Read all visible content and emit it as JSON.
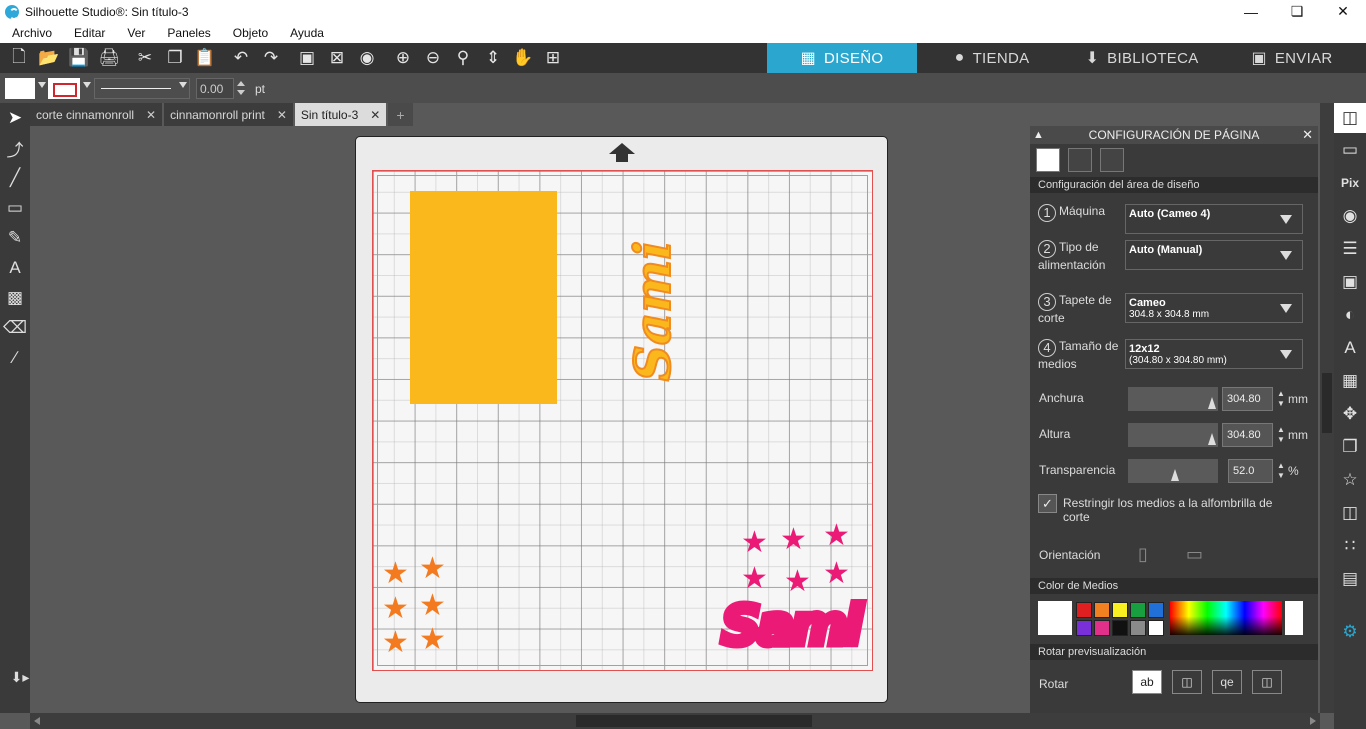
{
  "window": {
    "title": "Silhouette Studio®: Sin título-3"
  },
  "menu": [
    "Archivo",
    "Editar",
    "Ver",
    "Paneles",
    "Objeto",
    "Ayuda"
  ],
  "nav_tabs": [
    {
      "label": "DISEÑO",
      "icon": "grid-icon",
      "active": true
    },
    {
      "label": "TIENDA",
      "icon": "silhouette-s-icon",
      "active": false
    },
    {
      "label": "BIBLIOTECA",
      "icon": "library-icon",
      "active": false
    },
    {
      "label": "ENVIAR",
      "icon": "send-icon",
      "active": false
    }
  ],
  "line_settings": {
    "width_value": "0.00",
    "unit": "pt"
  },
  "doc_tabs": [
    {
      "label": "corte cinnamonroll",
      "active": false
    },
    {
      "label": "cinnamonroll print",
      "active": false
    },
    {
      "label": "Sin título-3",
      "active": true
    }
  ],
  "canvas": {
    "text_vertical": "Sami",
    "text_bottom": "Sami",
    "colors": {
      "yellow": "#fbb81d",
      "orange": "#f47a1f",
      "pink": "#ea1a76"
    }
  },
  "page_setup": {
    "title": "CONFIGURACIÓN DE PÁGINA",
    "section_design": "Configuración del área de diseño",
    "machine": {
      "num": "1",
      "label": "Máquina",
      "value": "Auto (Cameo 4)"
    },
    "feed": {
      "num": "2",
      "label": "Tipo de alimentación",
      "value": "Auto (Manual)"
    },
    "mat": {
      "num": "3",
      "label": "Tapete de corte",
      "value": "Cameo",
      "sub": "304.8 x 304.8 mm"
    },
    "media": {
      "num": "4",
      "label": "Tamaño de medios",
      "value": "12x12",
      "sub": "(304.80 x 304.80 mm)"
    },
    "width": {
      "label": "Anchura",
      "value": "304.80",
      "unit": "mm"
    },
    "height": {
      "label": "Altura",
      "value": "304.80",
      "unit": "mm"
    },
    "transparency": {
      "label": "Transparencia",
      "value": "52.0",
      "unit": "%"
    },
    "restrict": {
      "label": "Restringir los medios a la alfombrilla de corte",
      "checked": true
    },
    "orientation": {
      "label": "Orientación"
    },
    "section_color": "Color de Medios",
    "swatches": [
      "#e02020",
      "#f08020",
      "#f8f020",
      "#18a040",
      "#2070d8",
      "#7a30d8",
      "#e0308a",
      "#111111",
      "#8a8a8a",
      "#ffffff"
    ],
    "section_rotate": "Rotar previsualización",
    "rotate": {
      "label": "Rotar",
      "options": [
        "ab",
        "ab-90",
        "ab-180",
        "ab-270"
      ]
    }
  }
}
